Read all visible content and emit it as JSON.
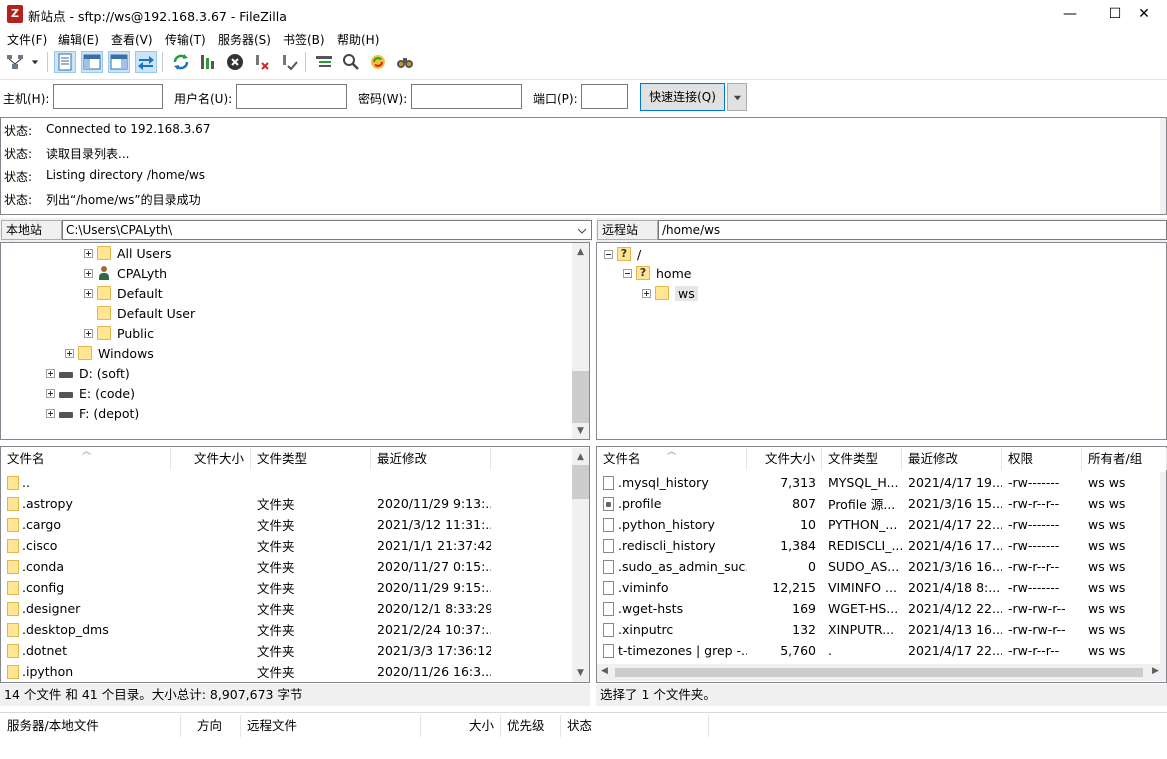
{
  "window": {
    "title": "新站点 - sftp://ws@192.168.3.67 - FileZilla",
    "app_icon_glyph": "Z",
    "min_glyph": "—",
    "max_glyph": "☐",
    "close_glyph": "✕"
  },
  "menu": [
    "文件(F)",
    "编辑(E)",
    "查看(V)",
    "传输(T)",
    "服务器(S)",
    "书签(B)",
    "帮助(H)"
  ],
  "toolbar": {
    "buttons": [
      "site-manager-icon",
      "site-manager-dropdown-icon",
      "toggle-message-log-icon",
      "toggle-local-tree-icon",
      "toggle-remote-tree-icon",
      "toggle-transfer-queue-icon",
      "refresh-icon",
      "process-queue-icon",
      "cancel-icon",
      "disconnect-icon",
      "reconnect-icon",
      "filter-icon",
      "search-icon",
      "compare-icon",
      "find-icon"
    ]
  },
  "quickconnect": {
    "host_label": "主机(H):",
    "host_value": "",
    "user_label": "用户名(U):",
    "user_value": "",
    "pass_label": "密码(W):",
    "pass_value": "",
    "port_label": "端口(P):",
    "port_value": "",
    "button_label": "快速连接(Q)"
  },
  "log": [
    {
      "label": "状态:",
      "text": "Connected to 192.168.3.67"
    },
    {
      "label": "状态:",
      "text": "读取目录列表..."
    },
    {
      "label": "状态:",
      "text": "Listing directory /home/ws"
    },
    {
      "label": "状态:",
      "text": "列出“/home/ws”的目录成功"
    }
  ],
  "local": {
    "path_label": "本地站点:",
    "path": "C:\\Users\\CPALyth\\",
    "tree": [
      {
        "label": "All Users",
        "icon": "folder"
      },
      {
        "label": "CPALyth",
        "icon": "user"
      },
      {
        "label": "Default",
        "icon": "folder"
      },
      {
        "label": "Default User",
        "icon": "folder"
      },
      {
        "label": "Public",
        "icon": "folder"
      },
      {
        "label": "Windows",
        "icon": "folder"
      },
      {
        "label": "D: (soft)",
        "icon": "drive"
      },
      {
        "label": "E: (code)",
        "icon": "drive"
      },
      {
        "label": "F: (depot)",
        "icon": "drive"
      }
    ],
    "columns": [
      "文件名",
      "文件大小",
      "文件类型",
      "最近修改"
    ],
    "files": [
      {
        "name": "..",
        "size": "",
        "type": "",
        "modified": ""
      },
      {
        "name": ".astropy",
        "size": "",
        "type": "文件夹",
        "modified": "2020/11/29 9:13:..."
      },
      {
        "name": ".cargo",
        "size": "",
        "type": "文件夹",
        "modified": "2021/3/12 11:31:..."
      },
      {
        "name": ".cisco",
        "size": "",
        "type": "文件夹",
        "modified": "2021/1/1 21:37:42"
      },
      {
        "name": ".conda",
        "size": "",
        "type": "文件夹",
        "modified": "2020/11/27 0:15:..."
      },
      {
        "name": ".config",
        "size": "",
        "type": "文件夹",
        "modified": "2020/11/29 9:15:..."
      },
      {
        "name": ".designer",
        "size": "",
        "type": "文件夹",
        "modified": "2020/12/1 8:33:29"
      },
      {
        "name": ".desktop_dms",
        "size": "",
        "type": "文件夹",
        "modified": "2021/2/24 10:37:..."
      },
      {
        "name": ".dotnet",
        "size": "",
        "type": "文件夹",
        "modified": "2021/3/3 17:36:12"
      },
      {
        "name": ".ipython",
        "size": "",
        "type": "文件夹",
        "modified": "2020/11/26 16:3..."
      }
    ],
    "status": "14 个文件 和 41 个目录。大小总计: 8,907,673 字节"
  },
  "remote": {
    "path_label": "远程站点:",
    "path": "/home/ws",
    "tree": [
      {
        "label": "/",
        "icon": "qfolder"
      },
      {
        "label": "home",
        "icon": "qfolder"
      },
      {
        "label": "ws",
        "icon": "folder"
      }
    ],
    "columns": [
      "文件名",
      "文件大小",
      "文件类型",
      "最近修改",
      "权限",
      "所有者/组"
    ],
    "files": [
      {
        "name": ".mysql_history",
        "size": "7,313",
        "type": "MYSQL_H...",
        "modified": "2021/4/17 19...",
        "perm": "-rw-------",
        "owner": "ws ws"
      },
      {
        "name": ".profile",
        "size": "807",
        "type": "Profile 源...",
        "modified": "2021/3/16 15...",
        "perm": "-rw-r--r--",
        "owner": "ws ws"
      },
      {
        "name": ".python_history",
        "size": "10",
        "type": "PYTHON_...",
        "modified": "2021/4/17 22...",
        "perm": "-rw-------",
        "owner": "ws ws"
      },
      {
        "name": ".rediscli_history",
        "size": "1,384",
        "type": "REDISCLI_...",
        "modified": "2021/4/16 17...",
        "perm": "-rw-------",
        "owner": "ws ws"
      },
      {
        "name": ".sudo_as_admin_suc...",
        "size": "0",
        "type": "SUDO_AS...",
        "modified": "2021/3/16 16...",
        "perm": "-rw-r--r--",
        "owner": "ws ws"
      },
      {
        "name": ".viminfo",
        "size": "12,215",
        "type": "VIMINFO ...",
        "modified": "2021/4/18 8:...",
        "perm": "-rw-------",
        "owner": "ws ws"
      },
      {
        "name": ".wget-hsts",
        "size": "169",
        "type": "WGET-HS...",
        "modified": "2021/4/12 22...",
        "perm": "-rw-rw-r--",
        "owner": "ws ws"
      },
      {
        "name": ".xinputrc",
        "size": "132",
        "type": "XINPUTR...",
        "modified": "2021/4/13 16...",
        "perm": "-rw-rw-r--",
        "owner": "ws ws"
      },
      {
        "name": "t-timezones | grep -...",
        "size": "5,760",
        "type": ".",
        "modified": "2021/4/17 22...",
        "perm": "-rw-r--r--",
        "owner": "ws ws"
      }
    ],
    "status": "选择了 1 个文件夹。"
  },
  "queue": {
    "columns": [
      "服务器/本地文件",
      "方向",
      "远程文件",
      "大小",
      "优先级",
      "状态"
    ]
  }
}
